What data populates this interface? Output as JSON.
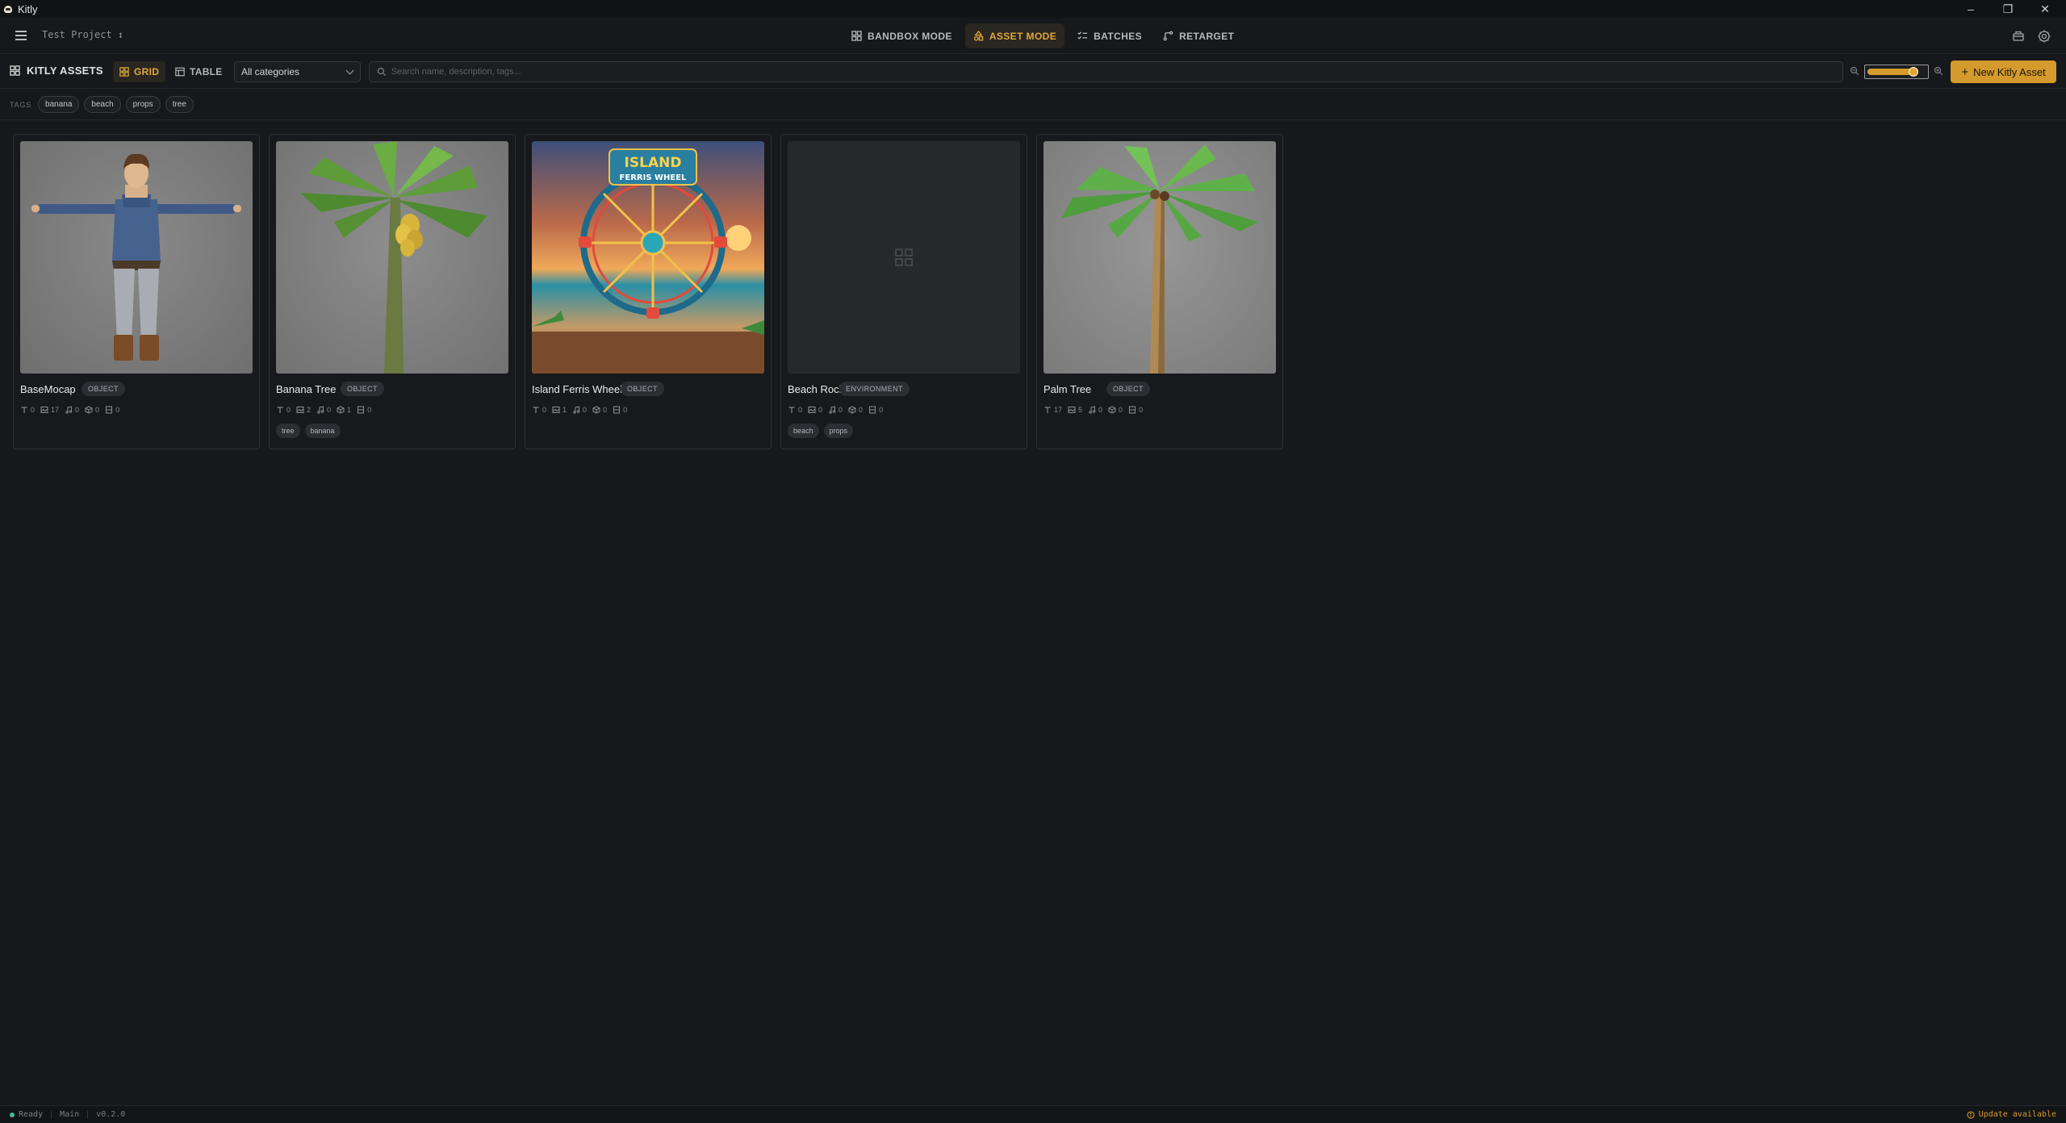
{
  "app": {
    "title": "Kitly"
  },
  "header": {
    "project_label": "Test Project ↕",
    "modes": [
      {
        "label": "BANDBOX MODE",
        "icon": "grid-icon",
        "active": false
      },
      {
        "label": "ASSET MODE",
        "icon": "shapes-icon",
        "active": true
      },
      {
        "label": "BATCHES",
        "icon": "list-icon",
        "active": false
      },
      {
        "label": "RETARGET",
        "icon": "branch-icon",
        "active": false
      }
    ]
  },
  "toolbar": {
    "title": "KITLY ASSETS",
    "view_grid": "GRID",
    "view_table": "TABLE",
    "category_value": "All categories",
    "search_placeholder": "Search name, description, tags...",
    "zoom_level": 0.8,
    "new_asset_label": "New Kitly Asset"
  },
  "tags": {
    "label": "TAGS",
    "items": [
      "banana",
      "beach",
      "props",
      "tree"
    ]
  },
  "assets": [
    {
      "name": "BaseMocap",
      "badge": "OBJECT",
      "stats": [
        "0",
        "17",
        "0",
        "0",
        "0"
      ],
      "tags": [],
      "thumb": "character"
    },
    {
      "name": "Banana Tree",
      "badge": "OBJECT",
      "stats": [
        "0",
        "2",
        "0",
        "1",
        "0"
      ],
      "tags": [
        "tree",
        "banana"
      ],
      "thumb": "banana-tree"
    },
    {
      "name": "Island Ferris Wheel",
      "badge": "OBJECT",
      "stats": [
        "0",
        "1",
        "0",
        "0",
        "0"
      ],
      "tags": [],
      "thumb": "ferris-wheel"
    },
    {
      "name": "Beach Rock",
      "badge": "ENVIRONMENT",
      "stats": [
        "0",
        "0",
        "0",
        "0",
        "0"
      ],
      "tags": [
        "beach",
        "props"
      ],
      "thumb": "placeholder"
    },
    {
      "name": "Palm Tree",
      "badge": "OBJECT",
      "stats": [
        "17",
        "5",
        "0",
        "0",
        "0"
      ],
      "tags": [],
      "thumb": "palm-tree"
    }
  ],
  "thumb_ferris_text": {
    "line1": "ISLAND",
    "line2": "FERRIS WHEEL"
  },
  "status": {
    "state": "Ready",
    "branch": "Main",
    "version": "v0.2.0",
    "update": "Update available"
  }
}
